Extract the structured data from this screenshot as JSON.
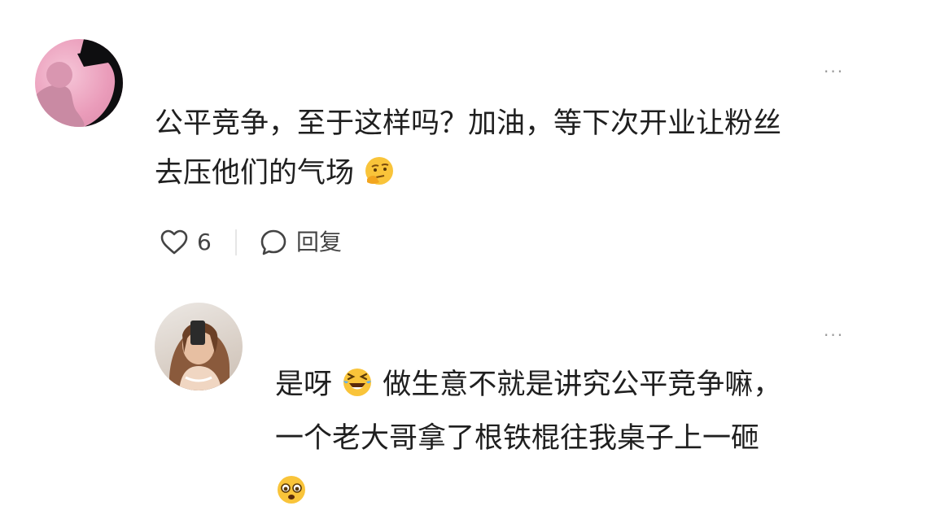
{
  "comments": [
    {
      "more_label": "···",
      "text_lines": [
        "公平竞争，至于这样吗？加油，等下次开业让粉丝",
        "去压他们的气场"
      ],
      "emoji": "thinking-face",
      "like_count": "6",
      "reply_label": "回复"
    },
    {
      "more_label": "···",
      "text_part_1": "是呀",
      "emoji_1": "laughing-crying-face",
      "text_part_2": "做生意不就是讲究公平竞争嘛，",
      "text_line_2": "一个老大哥拿了根铁棍往我桌子上一砸",
      "emoji_2": "fearful-face"
    }
  ],
  "colors": {
    "text": "#1f1f1f",
    "secondary": "#444444",
    "muted": "#9a9a9a",
    "emoji_yellow": "#f9c43a"
  }
}
